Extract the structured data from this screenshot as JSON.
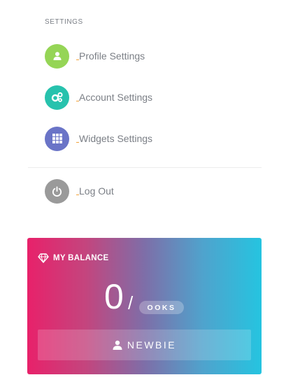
{
  "settings": {
    "section_title": "SETTINGS",
    "items": [
      {
        "label": "Profile Settings",
        "icon": "user-icon",
        "color": "#95d556"
      },
      {
        "label": "Account Settings",
        "icon": "gears-icon",
        "color": "#27c2ad"
      },
      {
        "label": "Widgets Settings",
        "icon": "grid-icon",
        "color": "#6a74c7"
      }
    ],
    "logout": {
      "label": "Log Out",
      "icon": "power-icon",
      "color": "#9a9a9a"
    }
  },
  "balance": {
    "title": "MY BALANCE",
    "icon": "diamond-icon",
    "amount": "0",
    "slash": "/",
    "currency": "OOKS",
    "rank": "NEWBIE",
    "rank_icon": "user-icon"
  }
}
